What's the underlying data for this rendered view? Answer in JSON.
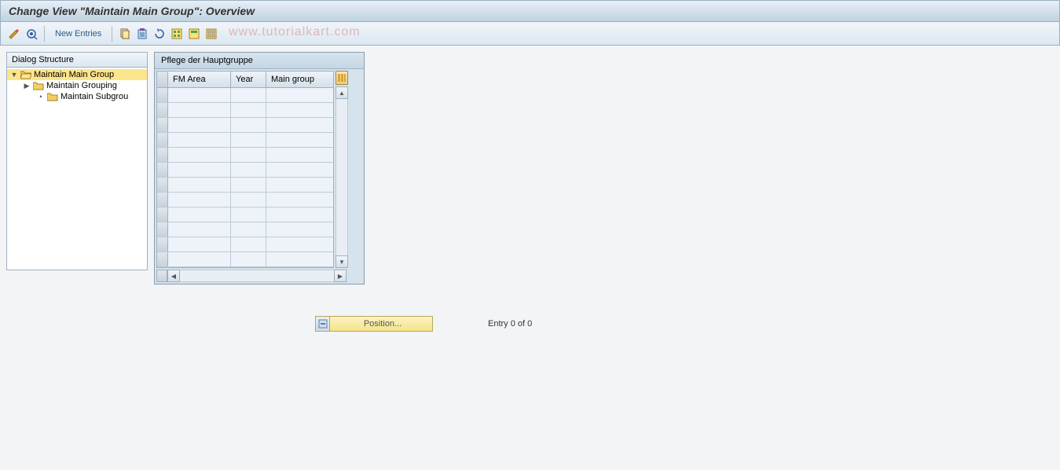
{
  "title": "Change View \"Maintain Main Group\": Overview",
  "toolbar": {
    "new_entries": "New Entries"
  },
  "watermark": "www.tutorialkart.com",
  "tree": {
    "header": "Dialog Structure",
    "items": [
      {
        "label": "Maintain Main Group",
        "selected": true,
        "open": true
      },
      {
        "label": "Maintain Grouping",
        "selected": false,
        "open": false
      },
      {
        "label": "Maintain Subgrou",
        "selected": false,
        "open": false
      }
    ]
  },
  "table": {
    "title": "Pflege der Hauptgruppe",
    "columns": [
      "FM Area",
      "Year",
      "Main group"
    ],
    "rows": 12
  },
  "footer": {
    "position": "Position...",
    "entry": "Entry 0 of 0"
  }
}
